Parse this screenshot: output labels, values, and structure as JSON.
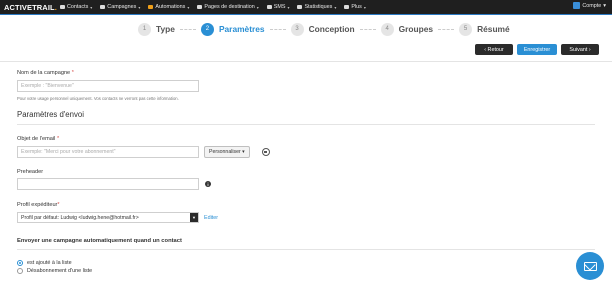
{
  "topbar": {
    "logo": "ACTIVETRAIL",
    "nav": [
      {
        "label": "Contacts",
        "icon": "person-icon"
      },
      {
        "label": "Campagnes",
        "icon": "envelope-icon"
      },
      {
        "label": "Automations",
        "icon": "automation-icon"
      },
      {
        "label": "Pages de destination",
        "icon": "page-icon"
      },
      {
        "label": "SMS",
        "icon": "mobile-icon"
      },
      {
        "label": "Statistiques",
        "icon": "chart-icon"
      },
      {
        "label": "Plus",
        "icon": "grid-icon"
      }
    ],
    "account": "Compte"
  },
  "stepper": [
    {
      "num": "1",
      "label": "Type"
    },
    {
      "num": "2",
      "label": "Paramètres"
    },
    {
      "num": "3",
      "label": "Conception"
    },
    {
      "num": "4",
      "label": "Groupes"
    },
    {
      "num": "5",
      "label": "Résumé"
    }
  ],
  "actions": {
    "back": "Retour",
    "save": "Enregistrer",
    "next": "Suivant"
  },
  "form": {
    "campaign_name_label": "Nom de la campagne",
    "campaign_name_placeholder": "Exemple : \"Bienvenue\"",
    "campaign_name_help": "Pour votre usage personnel uniquement. Vos contacts ne verront pas cette information.",
    "section_send": "Paramètres d'envoi",
    "subject_label": "Objet de l'email",
    "subject_placeholder": "Exemple: \"Merci pour votre abonnement\"",
    "personalize": "Personnaliser",
    "preheader_label": "Preheader",
    "sender_label": "Profil expéditeur",
    "sender_value": "Profil par défaut: Ludwig <ludwig.hene@hotmail.fr>",
    "edit": "Editer",
    "trigger_title": "Envoyer une campagne automatiquement quand un contact",
    "trigger_options": [
      "est ajouté à la liste",
      "Désabonnement d'une liste"
    ]
  }
}
